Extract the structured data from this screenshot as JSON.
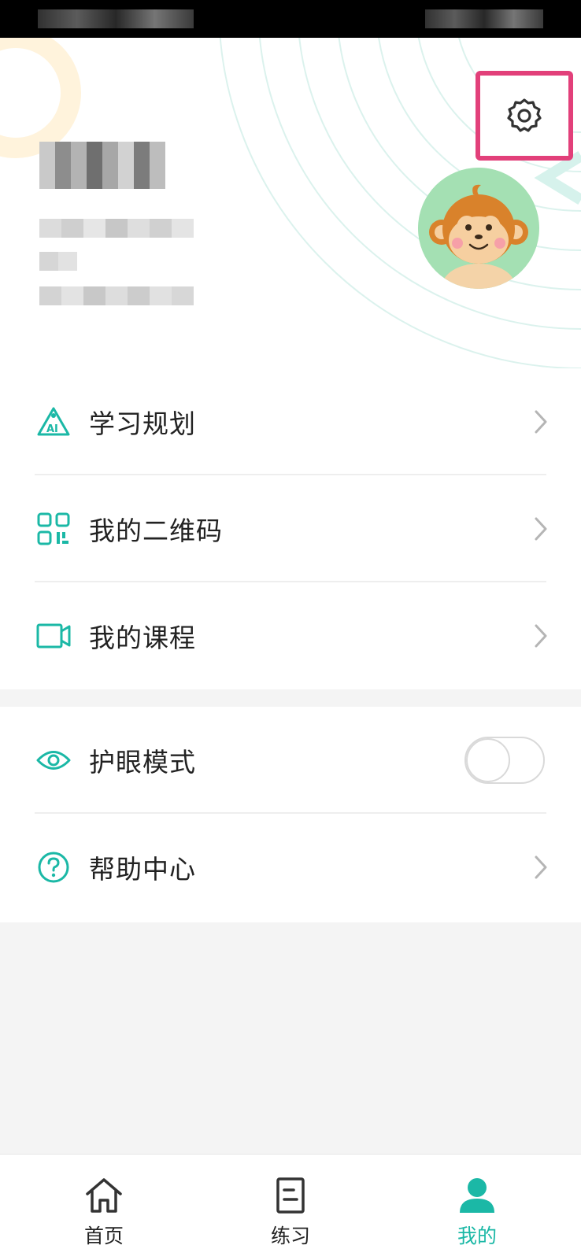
{
  "header": {
    "settings_icon": "gear-icon"
  },
  "menu_group_1": [
    {
      "label": "学习规划",
      "icon": "ai-plan-icon"
    },
    {
      "label": "我的二维码",
      "icon": "qr-code-icon"
    },
    {
      "label": "我的课程",
      "icon": "video-camera-icon"
    }
  ],
  "menu_group_2": [
    {
      "label": "护眼模式",
      "icon": "eye-icon",
      "toggle_on": false
    },
    {
      "label": "帮助中心",
      "icon": "help-circle-icon"
    }
  ],
  "tabbar": {
    "items": [
      {
        "label": "首页",
        "icon": "home-icon",
        "active": false
      },
      {
        "label": "练习",
        "icon": "document-icon",
        "active": false
      },
      {
        "label": "我的",
        "icon": "user-icon",
        "active": true
      }
    ]
  },
  "colors": {
    "accent": "#1bb8a6",
    "highlight_border": "#e2407a",
    "text": "#222222",
    "page_bg": "#f4f4f4"
  }
}
